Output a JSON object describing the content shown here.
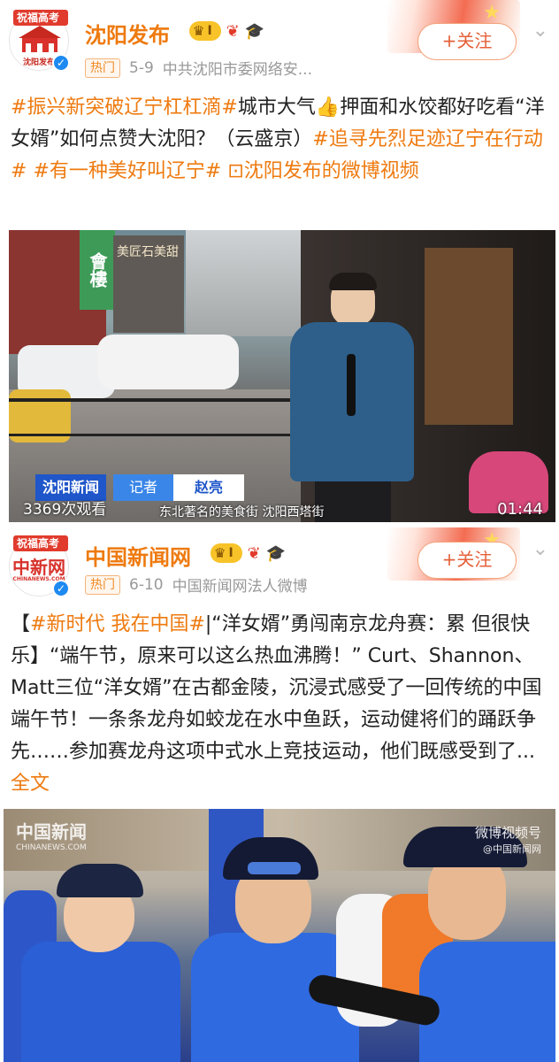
{
  "post1": {
    "account": "沈阳发布",
    "avatar_label": "沈阳发布",
    "ribbon": "祝福高考生",
    "badge_level": "I",
    "hot": "热门",
    "date": "5-9",
    "source": "中共沈阳市委网络安...",
    "follow": "+关注",
    "text": {
      "h1": "#振兴新突破辽宁杠杠滴#",
      "t1": "城市大气👍押面和水饺都好吃看“洋女婿”如何点赞大沈阳？（云盛京）",
      "h2": "#追寻先烈足迹辽宁在行动#",
      "t2": " ",
      "h3": "#有一种美好叫辽宁#",
      "t3": " ",
      "link": "⊡沈阳发布的微博视频"
    },
    "video": {
      "lt_logo": "沈阳新闻",
      "lt_role": "记者",
      "lt_name": "赵亮",
      "caption": "东北著名的美食街 沈阳西塔街",
      "views": "3369次观看",
      "duration": "01:44",
      "sign1": "會樓",
      "sign2": "美匠石美甜"
    }
  },
  "post2": {
    "account": "中国新闻网",
    "avatar_label": "中新网",
    "avatar_sub": "CHINANEWS.COM",
    "ribbon": "祝福高考生",
    "badge_level": "I",
    "hot": "热门",
    "date": "6-10",
    "source": "中国新闻网法人微博",
    "follow": "+关注",
    "text": {
      "t0": "【",
      "h1": "#新时代 我在中国#",
      "t1": "|“洋女婿”勇闯南京龙舟赛：累 但很快乐】“端午节，原来可以这么热血沸腾！” Curt、Shannon、Matt三位“洋女婿”在古都金陵，沉浸式感受了一回传统的中国端午节！一条条龙舟如蛟龙在水中鱼跃，运动健将们的踊跃争先……参加赛龙舟这项中式水上竞技运动，他们既感受到了...",
      "link": "全文"
    },
    "photo": {
      "wm_left": "中国新闻",
      "wm_left_sub": "CHINANEWS.COM",
      "wm_right": "微博视频号",
      "wm_right_sub": "@中国新闻网"
    }
  },
  "colors": {
    "accent": "#ee7a0f",
    "follow": "#e5603a",
    "verify": "#1d8af2",
    "vip": "#f7c328"
  }
}
